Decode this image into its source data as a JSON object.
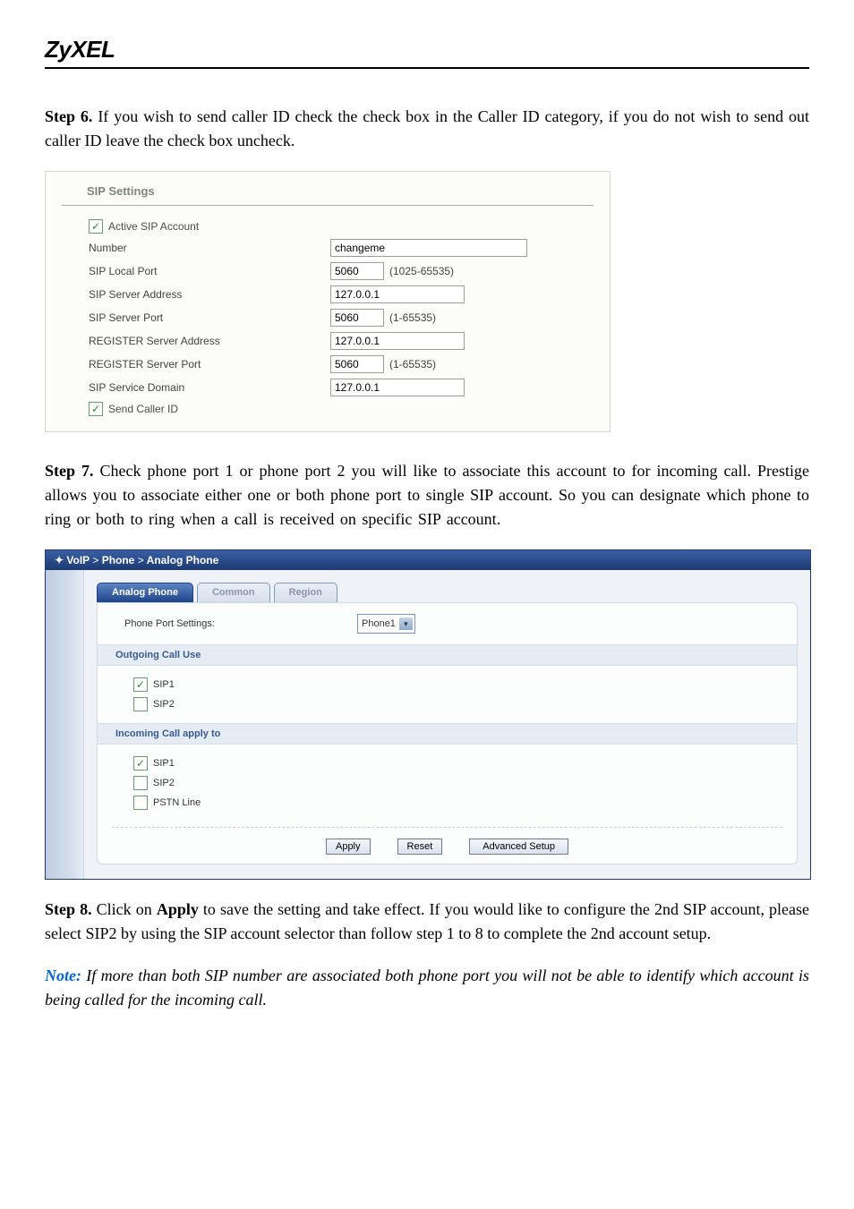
{
  "brand": "ZyXEL",
  "step6": {
    "label": "Step 6.",
    "text": "If you wish to send caller ID check the check box in the Caller ID category, if you do not wish to send out caller ID leave the check box uncheck."
  },
  "sip": {
    "title": "SIP Settings",
    "active_label": "Active SIP Account",
    "active_checked": "✓",
    "fields": {
      "number_label": "Number",
      "number_value": "changeme",
      "local_port_label": "SIP Local Port",
      "local_port_value": "5060",
      "local_port_range": "(1025-65535)",
      "server_addr_label": "SIP Server Address",
      "server_addr_value": "127.0.0.1",
      "server_port_label": "SIP Server Port",
      "server_port_value": "5060",
      "server_port_range": "(1-65535)",
      "reg_addr_label": "REGISTER Server Address",
      "reg_addr_value": "127.0.0.1",
      "reg_port_label": "REGISTER Server Port",
      "reg_port_value": "5060",
      "reg_port_range": "(1-65535)",
      "domain_label": "SIP Service Domain",
      "domain_value": "127.0.0.1"
    },
    "send_caller_label": "Send Caller ID",
    "send_caller_checked": "✓"
  },
  "step7": {
    "label": "Step 7.",
    "text": "Check phone port 1 or phone port 2 you will like to associate this account to for incoming call.  Prestige allows you to associate either one or both phone port to single SIP account.  So you can designate which phone to ring or both to ring when a call is received on specific SIP account."
  },
  "voip": {
    "breadcrumb_icon": "✦",
    "breadcrumb": {
      "a": "VoIP",
      "b": "Phone",
      "c": "Analog Phone",
      "sep": ">"
    },
    "tabs": {
      "active": "Analog Phone",
      "common": "Common",
      "region": "Region"
    },
    "port_label": "Phone Port Settings:",
    "port_value": "Phone1",
    "outgoing_header": "Outgoing Call Use",
    "outgoing": {
      "sip1_label": "SIP1",
      "sip1_checked": "✓",
      "sip2_label": "SIP2",
      "sip2_checked": ""
    },
    "incoming_header": "Incoming Call apply to",
    "incoming": {
      "sip1_label": "SIP1",
      "sip1_checked": "✓",
      "sip2_label": "SIP2",
      "sip2_checked": "",
      "pstn_label": "PSTN Line",
      "pstn_checked": ""
    },
    "buttons": {
      "apply": "Apply",
      "reset": "Reset",
      "adv": "Advanced Setup"
    }
  },
  "step8": {
    "label": "Step 8.",
    "text_a": "Click on ",
    "text_b": "Apply",
    "text_c": " to save the setting and take effect.  If you would like to configure the 2nd SIP account, please select SIP2 by using the SIP account selector than follow step 1 to 8 to complete the 2nd account setup."
  },
  "note": {
    "label": "Note:",
    "text": " If more than both SIP number are associated both phone port you will not be able to identify which account is being called for the incoming call."
  }
}
